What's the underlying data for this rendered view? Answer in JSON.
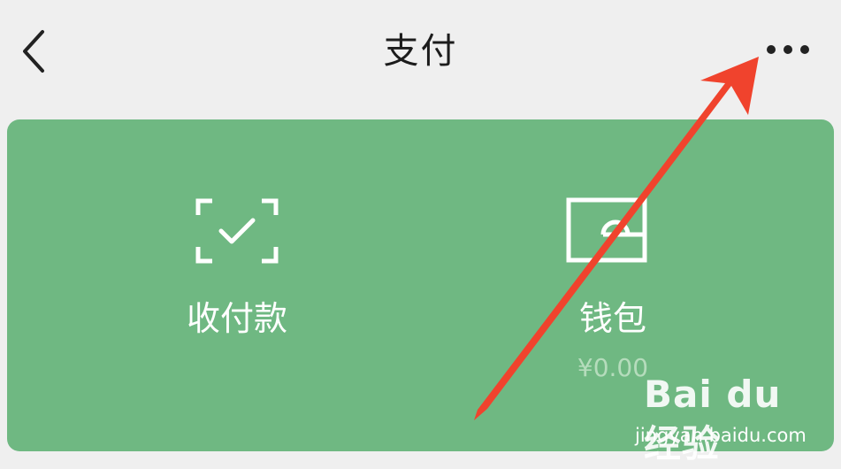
{
  "header": {
    "title": "支付",
    "back_icon": "chevron-left-icon",
    "more_icon": "more-dots-icon"
  },
  "card": {
    "background_color": "#6fb882",
    "tiles": [
      {
        "label": "收付款",
        "icon": "scan-check-icon"
      },
      {
        "label": "钱包",
        "sub": "¥0.00",
        "icon": "wallet-icon"
      }
    ]
  },
  "annotation": {
    "color": "#f0432d",
    "icon": "red-arrow"
  },
  "watermark": {
    "brand": "Bai du 经验",
    "url": "jingyan.baidu.com"
  }
}
